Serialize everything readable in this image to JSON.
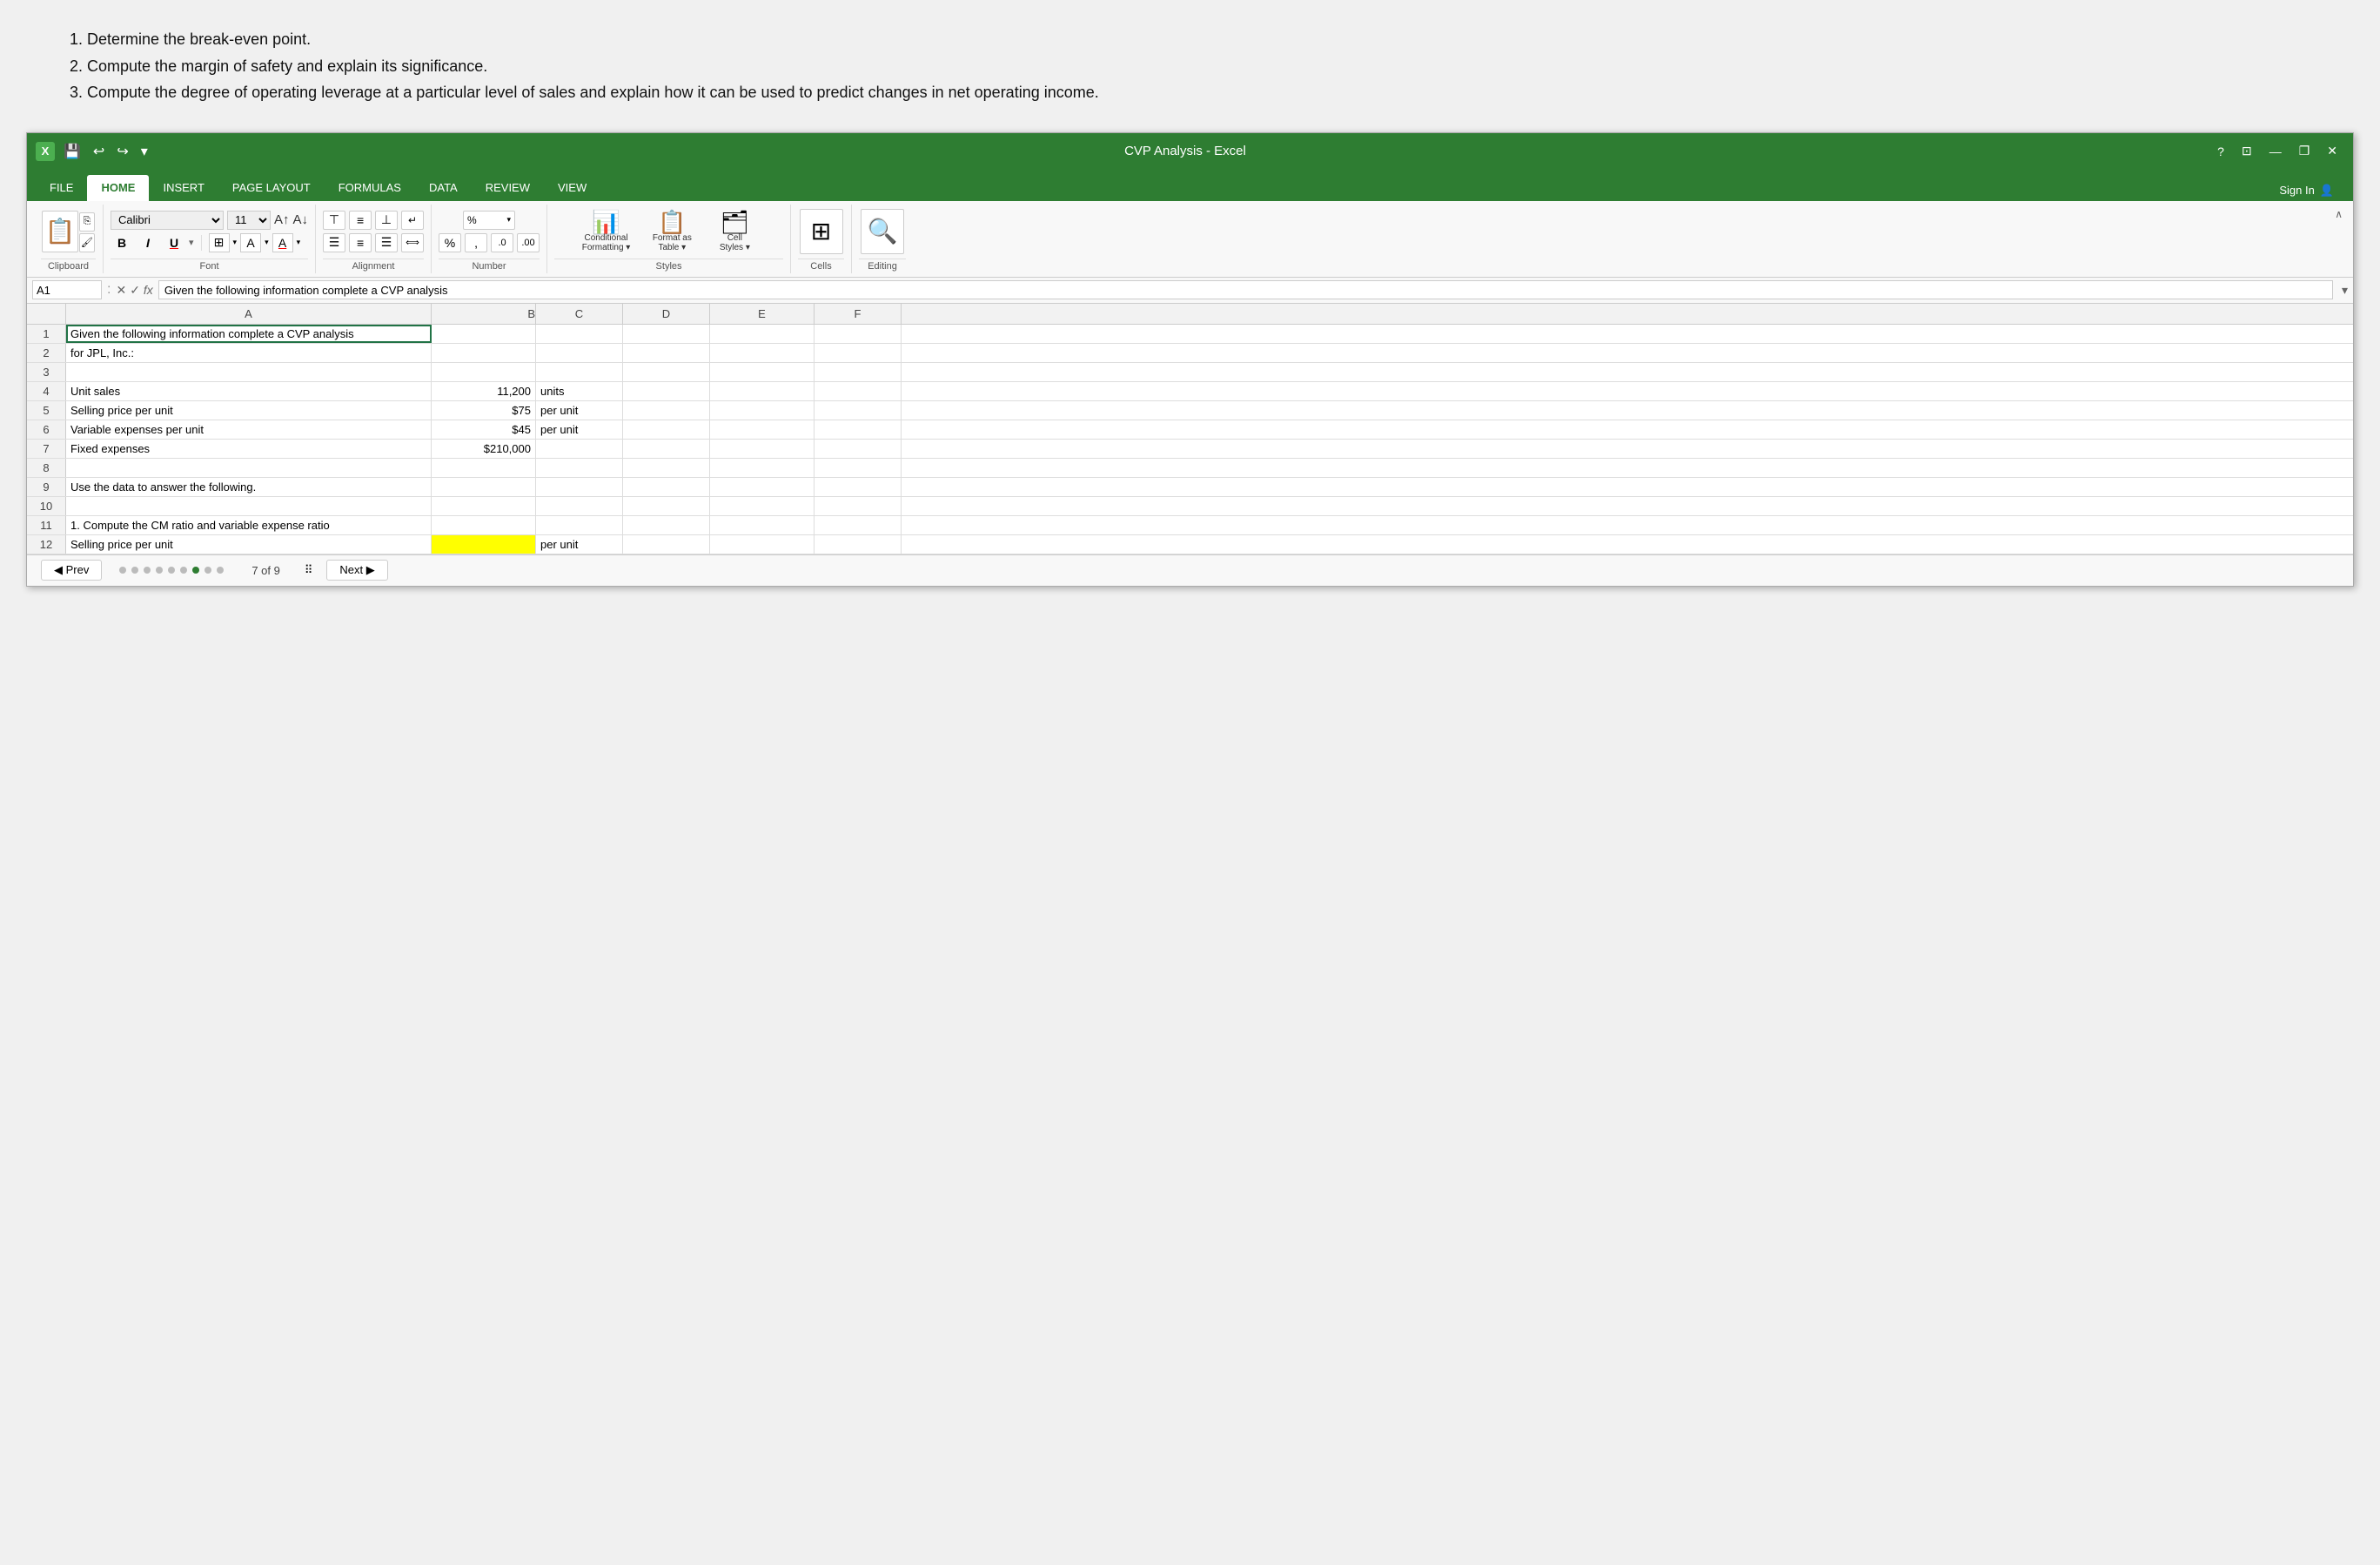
{
  "top_text": {
    "lines": [
      "1. Determine the break-even point.",
      "2. Compute the margin of safety and explain its significance.",
      "3. Compute the degree of operating leverage at a particular level of sales and explain how it can be used to predict changes in net operating income."
    ]
  },
  "titlebar": {
    "app_name": "CVP Analysis - Excel",
    "question_mark": "?",
    "minimize": "—",
    "restore": "❐",
    "close": "✕"
  },
  "ribbon_tabs": {
    "items": [
      {
        "label": "FILE",
        "active": false
      },
      {
        "label": "HOME",
        "active": true
      },
      {
        "label": "INSERT",
        "active": false
      },
      {
        "label": "PAGE LAYOUT",
        "active": false
      },
      {
        "label": "FORMULAS",
        "active": false
      },
      {
        "label": "DATA",
        "active": false
      },
      {
        "label": "REVIEW",
        "active": false
      },
      {
        "label": "VIEW",
        "active": false
      }
    ],
    "sign_in": "Sign In"
  },
  "ribbon": {
    "clipboard_label": "Clipboard",
    "font_label": "Font",
    "styles_label": "Styles",
    "cells_label": "Cells",
    "editing_label": "Editing",
    "font_name": "Calibri",
    "font_size": "11",
    "paste_label": "Paste",
    "bold": "B",
    "italic": "I",
    "underline": "U",
    "alignment_label": "Alignment",
    "number_label": "Number",
    "conditional_label": "Conditional\nFormatting",
    "format_table_label": "Format as\nTable",
    "cell_styles_label": "Cell\nStyles",
    "cells_btn_label": "Cells",
    "editing_btn_label": "Editing"
  },
  "formula_bar": {
    "cell_ref": "A1",
    "formula_content": "Given the following information complete a CVP analysis"
  },
  "columns": [
    "A",
    "B",
    "C",
    "D",
    "E",
    "F"
  ],
  "rows": [
    {
      "num": 1,
      "a": "Given the following information complete a CVP analysis",
      "b": "",
      "c": "",
      "d": "",
      "e": "",
      "f": ""
    },
    {
      "num": 2,
      "a": "for JPL, Inc.:",
      "b": "",
      "c": "",
      "d": "",
      "e": "",
      "f": ""
    },
    {
      "num": 3,
      "a": "",
      "b": "",
      "c": "",
      "d": "",
      "e": "",
      "f": ""
    },
    {
      "num": 4,
      "a": "Unit sales",
      "b": "11,200",
      "c": "units",
      "d": "",
      "e": "",
      "f": ""
    },
    {
      "num": 5,
      "a": "Selling price per unit",
      "b": "$75",
      "c": "per unit",
      "d": "",
      "e": "",
      "f": ""
    },
    {
      "num": 6,
      "a": "Variable expenses per unit",
      "b": "$45",
      "c": "per unit",
      "d": "",
      "e": "",
      "f": ""
    },
    {
      "num": 7,
      "a": "Fixed expenses",
      "b": "$210,000",
      "c": "",
      "d": "",
      "e": "",
      "f": ""
    },
    {
      "num": 8,
      "a": "",
      "b": "",
      "c": "",
      "d": "",
      "e": "",
      "f": ""
    },
    {
      "num": 9,
      "a": "Use the data to answer the following.",
      "b": "",
      "c": "",
      "d": "",
      "e": "",
      "f": ""
    },
    {
      "num": 10,
      "a": "",
      "b": "",
      "c": "",
      "d": "",
      "e": "",
      "f": ""
    },
    {
      "num": 11,
      "a": "1. Compute the CM ratio and variable expense ratio",
      "b": "",
      "c": "",
      "d": "",
      "e": "",
      "f": ""
    },
    {
      "num": 12,
      "a": "Selling price per unit",
      "b": "",
      "c": "per unit",
      "d": "",
      "e": "",
      "f": "",
      "b_highlighted": true
    }
  ],
  "bottom_bar": {
    "prev_label": "◀  Prev",
    "page_indicator": "7 of 9",
    "next_label": "Next  ▶"
  }
}
